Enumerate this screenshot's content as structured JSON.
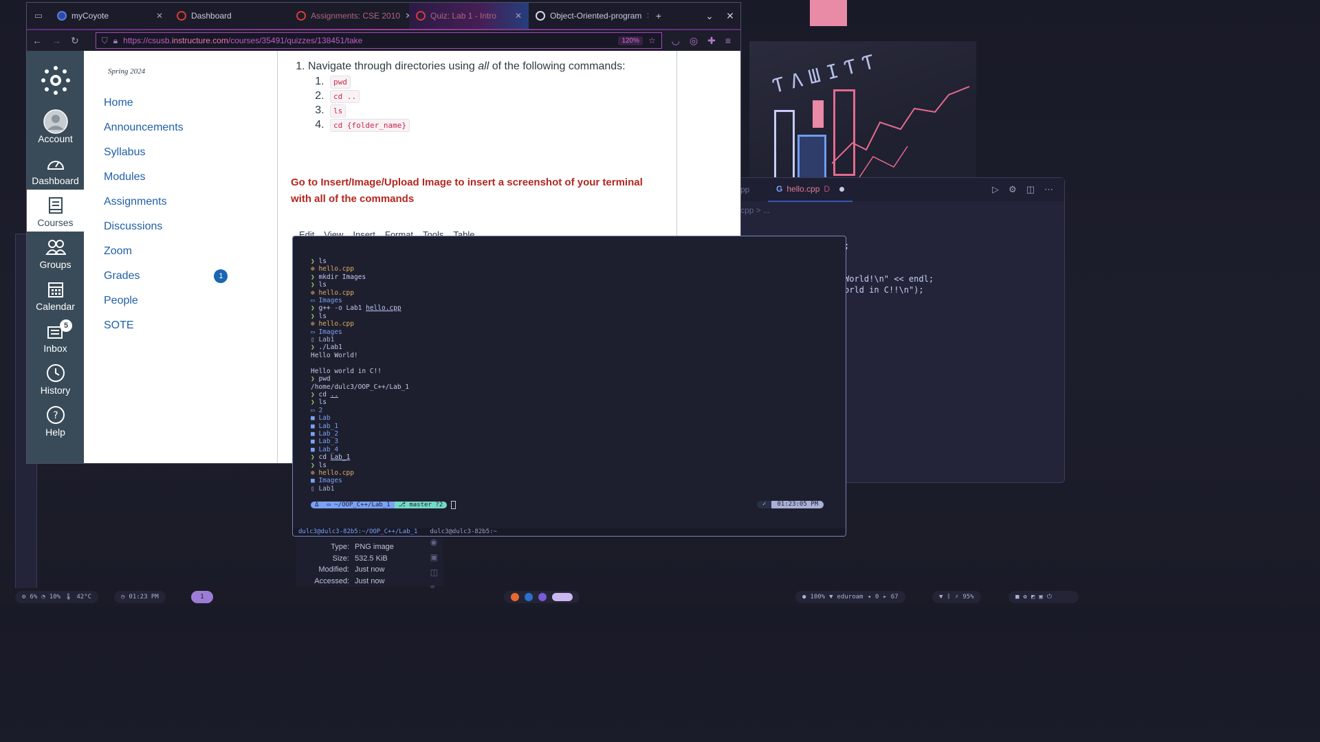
{
  "browser": {
    "tabs": [
      {
        "title": "myCoyote",
        "favicon": "coyote-icon"
      },
      {
        "title": "Dashboard",
        "favicon": "canvas-icon"
      },
      {
        "title": "Assignments: CSE 2010",
        "favicon": "canvas-icon"
      },
      {
        "title": "Quiz: Lab 1 - Intro",
        "favicon": "canvas-icon"
      },
      {
        "title": "Object-Oriented-program",
        "favicon": "github-icon"
      }
    ],
    "url_prefix": "https://csusb.",
    "url_domain": "instructure.com",
    "url_path": "/courses/35491/quizzes/138451/take",
    "zoom": "120%"
  },
  "global_nav": {
    "items": [
      {
        "label": "Account",
        "icon": "avatar-icon"
      },
      {
        "label": "Dashboard",
        "icon": "dashboard-icon"
      },
      {
        "label": "Courses",
        "icon": "courses-icon"
      },
      {
        "label": "Groups",
        "icon": "groups-icon"
      },
      {
        "label": "Calendar",
        "icon": "calendar-icon"
      },
      {
        "label": "Inbox",
        "icon": "inbox-icon",
        "badge": "5"
      },
      {
        "label": "History",
        "icon": "history-icon"
      },
      {
        "label": "Help",
        "icon": "help-icon"
      }
    ]
  },
  "course_nav": {
    "term": "Spring 2024",
    "items": [
      {
        "label": "Home"
      },
      {
        "label": "Announcements"
      },
      {
        "label": "Syllabus"
      },
      {
        "label": "Modules"
      },
      {
        "label": "Assignments"
      },
      {
        "label": "Discussions"
      },
      {
        "label": "Zoom"
      },
      {
        "label": "Grades",
        "badge": "1"
      },
      {
        "label": "People"
      },
      {
        "label": "SOTE"
      }
    ]
  },
  "question": {
    "lead": "Navigate through directories using ",
    "emph": "all",
    "tail": " of the following commands:",
    "commands": [
      "pwd",
      "cd ..",
      "ls",
      "cd {folder_name}"
    ],
    "instruction": "Go to Insert/Image/Upload  Image to insert a screenshot of your terminal with all of the commands",
    "editor_menu": [
      "Edit",
      "View",
      "Insert",
      "Format",
      "Tools",
      "Table"
    ]
  },
  "terminal": {
    "prompt_path": "~/OOP_C++/Lab_1",
    "git_branch": "master ?2",
    "time": "01:23:05 PM",
    "tmux_sessions": [
      "dulc3@dulc3-82b5:~/OOP_C++/Lab_1",
      "dulc3@dulc3-82b5:~"
    ]
  },
  "editor": {
    "prev_tab": "pp",
    "tab": "hello.cpp",
    "tab_badge": "D",
    "breadcrumb": "cpp > ...",
    "code_lines": [
      "World!\\n\" << endl;",
      "orld in C!!\\n\");"
    ]
  },
  "file_info": {
    "type_label": "Type:",
    "type": "PNG image",
    "size_label": "Size:",
    "size": "532.5 KiB",
    "modified_label": "Modified:",
    "modified": "Just now",
    "accessed_label": "Accessed:",
    "accessed": "Just now"
  },
  "statusbar": {
    "cpu": "6%",
    "mem": "10%",
    "temp": "42°C",
    "clock": "01:23 PM",
    "workspace": "1",
    "brightness": "100%",
    "wifi": "eduroam",
    "net_in": "0",
    "net_out": "67",
    "battery": "95%"
  },
  "colors": {
    "canvas_nav": "#394b58",
    "link": "#1f5fa8",
    "instruction_red": "#b3261e",
    "accent_pink": "#d56fd6"
  }
}
